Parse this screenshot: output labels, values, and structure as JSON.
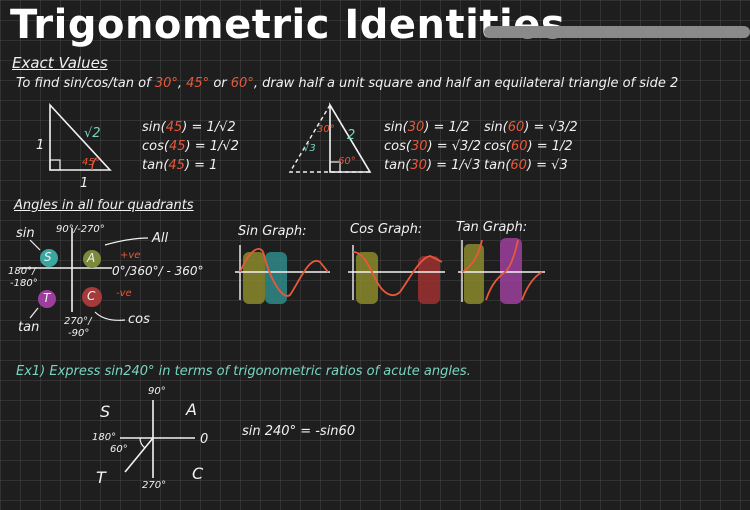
{
  "header": {
    "title": "Trigonometric Identities"
  },
  "exact_values": {
    "heading": "Exact Values",
    "intro": {
      "p1": "To find sin/cos/tan of",
      "a30": "30°",
      "sep1": ",",
      "a45": "45°",
      "or": "or",
      "a60": "60°",
      "p2": ", draw half a unit square and half an equilateral triangle of side 2"
    },
    "square_triangle": {
      "side_left": "1",
      "hyp": "√2",
      "angle": "45°",
      "bottom": "1"
    },
    "values45": [
      {
        "fn": "sin",
        "ang": "45",
        "rest": ") = 1/√2"
      },
      {
        "fn": "cos",
        "ang": "45",
        "rest": ") = 1/√2"
      },
      {
        "fn": "tan",
        "ang": "45",
        "rest": ") = 1"
      }
    ],
    "equilateral": {
      "top_angle": "30°",
      "hyp": "2",
      "height": "√3",
      "bottom_angle": "60°"
    },
    "values30": [
      {
        "fn": "sin",
        "ang": "30",
        "rest": ") = 1/2"
      },
      {
        "fn": "cos",
        "ang": "30",
        "rest": ") = √3/2"
      },
      {
        "fn": "tan",
        "ang": "30",
        "rest": ") = 1/√3"
      }
    ],
    "values60": [
      {
        "fn": "sin",
        "ang": "60",
        "rest": ") = √3/2"
      },
      {
        "fn": "cos",
        "ang": "60",
        "rest": ") = 1/2"
      },
      {
        "fn": "tan",
        "ang": "60",
        "rest": ") = √3"
      }
    ]
  },
  "quadrants": {
    "heading": "Angles in all four quadrants",
    "sin": "sin",
    "top": "90°/-270°",
    "all": "All",
    "plus_ve": "+ve",
    "right": "0°/360°/ - 360°",
    "left1": "180°/",
    "left2": "-180°",
    "minus_ve": "-ve",
    "bottom1": "270°/",
    "bottom2": "-90°",
    "cos": "cos",
    "tan": "tan",
    "S": "S",
    "A": "A",
    "T": "T",
    "C": "C"
  },
  "graphs": {
    "sin": "Sin Graph:",
    "cos": "Cos Graph:",
    "tan": "Tan Graph:"
  },
  "example": {
    "prefix": "Ex1)",
    "text": "Express sin240° in terms of trigonometric ratios of acute angles.",
    "top": "90°",
    "bottom": "270°",
    "left": "180°",
    "right": "0",
    "angle": "60°",
    "S": "S",
    "A": "A",
    "T": "T",
    "C": "C",
    "answer": "sin 240°  =  -sin60"
  }
}
